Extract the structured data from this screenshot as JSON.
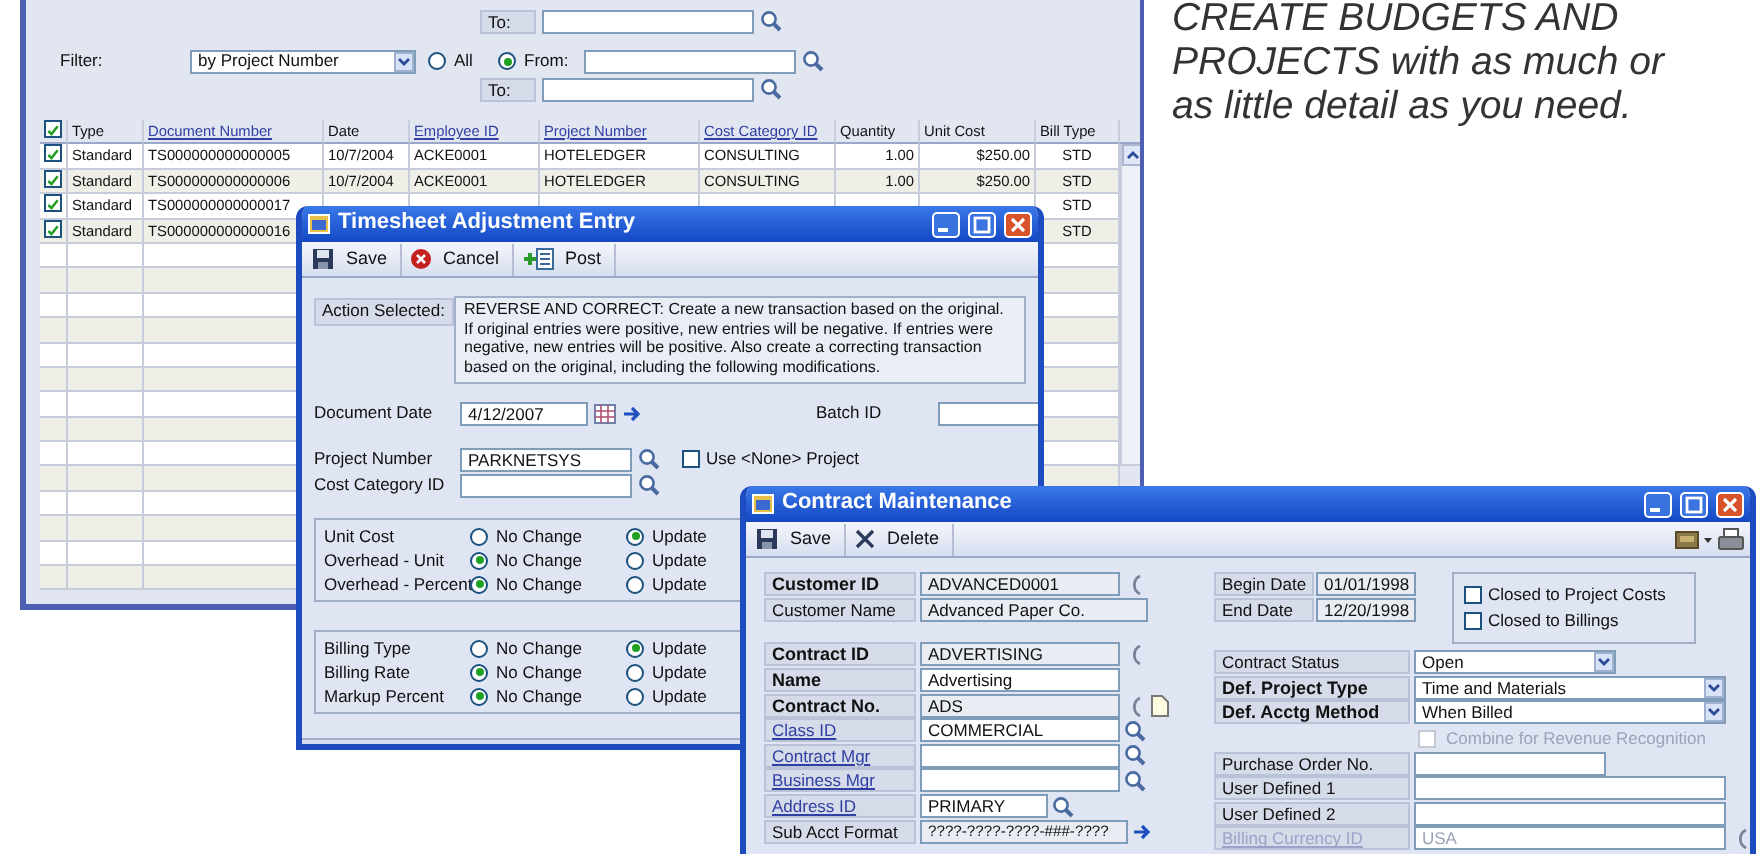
{
  "caption": "CREATE BUDGETS AND PROJECTS with as much or as little detail as you need.",
  "inquiry_window": {
    "top_range": {
      "to_label": "To:"
    },
    "filter": {
      "label": "Filter:",
      "value": "by Project Number",
      "options": [
        {
          "label": "All",
          "selected": false
        },
        {
          "label": "From:",
          "selected": true
        }
      ],
      "to_label": "To:"
    },
    "table": {
      "all_checked": true,
      "columns": [
        {
          "label": "Type",
          "link": false
        },
        {
          "label": "Document Number",
          "link": true
        },
        {
          "label": "Date",
          "link": false
        },
        {
          "label": "Employee ID",
          "link": true
        },
        {
          "label": "Project Number",
          "link": true
        },
        {
          "label": "Cost Category ID",
          "link": true
        },
        {
          "label": "Quantity",
          "link": false
        },
        {
          "label": "Unit Cost",
          "link": false
        },
        {
          "label": "Bill Type",
          "link": false
        }
      ],
      "rows": [
        {
          "checked": true,
          "cells": [
            "Standard",
            "TS000000000000005",
            "10/7/2004",
            "ACKE0001",
            "HOTELEDGER",
            "CONSULTING",
            "1.00",
            "$250.00",
            "STD"
          ]
        },
        {
          "checked": true,
          "cells": [
            "Standard",
            "TS000000000000006",
            "10/7/2004",
            "ACKE0001",
            "HOTELEDGER",
            "CONSULTING",
            "1.00",
            "$250.00",
            "STD"
          ]
        },
        {
          "checked": true,
          "cells": [
            "Standard",
            "TS000000000000017",
            null,
            null,
            null,
            null,
            null,
            null,
            "STD"
          ]
        },
        {
          "checked": true,
          "cells": [
            "Standard",
            "TS000000000000016",
            null,
            null,
            null,
            null,
            null,
            null,
            "STD"
          ]
        }
      ]
    }
  },
  "timesheet_window": {
    "title": "Timesheet Adjustment Entry",
    "toolbar": [
      {
        "kind": "save",
        "label": "Save"
      },
      {
        "kind": "cancel",
        "label": "Cancel"
      },
      {
        "kind": "post",
        "label": "Post"
      }
    ],
    "action": {
      "label": "Action Selected:",
      "text": "REVERSE AND CORRECT: Create a new transaction based on the original. If original entries were positive, new entries will be negative. If entries were negative, new entries will be positive. Also create a correcting transaction based on the original, including the following modifications."
    },
    "document_date": {
      "label": "Document Date",
      "value": "4/12/2007"
    },
    "batch_id": {
      "label": "Batch ID"
    },
    "project_number": {
      "label": "Project Number",
      "value": "PARKNETSYS"
    },
    "use_none_project": {
      "label": "Use <None> Project",
      "checked": false
    },
    "cost_category": {
      "label": "Cost Category ID"
    },
    "groups": [
      [
        {
          "label": "Unit Cost",
          "options": [
            {
              "label": "No Change",
              "selected": false
            },
            {
              "label": "Update",
              "selected": true
            }
          ]
        },
        {
          "label": "Overhead - Unit",
          "options": [
            {
              "label": "No Change",
              "selected": true
            },
            {
              "label": "Update",
              "selected": false
            }
          ]
        },
        {
          "label": "Overhead - Percent",
          "options": [
            {
              "label": "No Change",
              "selected": true
            },
            {
              "label": "Update",
              "selected": false
            }
          ]
        }
      ],
      [
        {
          "label": "Billing Type",
          "options": [
            {
              "label": "No Change",
              "selected": false
            },
            {
              "label": "Update",
              "selected": true
            }
          ]
        },
        {
          "label": "Billing Rate",
          "options": [
            {
              "label": "No Change",
              "selected": true
            },
            {
              "label": "Update",
              "selected": false
            }
          ]
        },
        {
          "label": "Markup Percent",
          "options": [
            {
              "label": "No Change",
              "selected": true
            },
            {
              "label": "Update",
              "selected": false
            }
          ]
        }
      ]
    ]
  },
  "contract_window": {
    "title": "Contract Maintenance",
    "toolbar": [
      {
        "kind": "save",
        "label": "Save"
      },
      {
        "kind": "delete",
        "label": "Delete"
      }
    ],
    "left_sections": [
      [
        {
          "label": "Customer ID",
          "required": true,
          "link": false,
          "value": "ADVANCED0001",
          "readonly": true,
          "kind": "ring"
        },
        {
          "label": "Customer Name",
          "required": false,
          "link": false,
          "value": "Advanced Paper Co.",
          "readonly": true,
          "kind": "wide"
        }
      ],
      [
        {
          "label": "Contract ID",
          "required": true,
          "link": false,
          "value": "ADVERTISING",
          "readonly": true,
          "kind": "ring"
        },
        {
          "label": "Name",
          "required": true,
          "link": false,
          "value": "Advertising",
          "readonly": false,
          "kind": "text"
        },
        {
          "label": "Contract No.",
          "required": true,
          "link": false,
          "value": "ADS",
          "readonly": true,
          "kind": "ring-note"
        },
        {
          "label": "Class ID",
          "required": false,
          "link": true,
          "value": "COMMERCIAL",
          "readonly": false,
          "kind": "lookup"
        },
        {
          "label": "Contract Mgr",
          "required": false,
          "link": true,
          "readonly": false,
          "kind": "lookup"
        },
        {
          "label": "Business Mgr",
          "required": false,
          "link": true,
          "readonly": false,
          "kind": "lookup"
        },
        {
          "label": "Address ID",
          "required": false,
          "link": true,
          "value": "PRIMARY",
          "readonly": false,
          "kind": "lookup-short"
        },
        {
          "label": "Sub Acct Format",
          "required": false,
          "link": false,
          "value": "????-????-????-###-????",
          "readonly": true,
          "kind": "arrow"
        }
      ]
    ],
    "dates": [
      {
        "label": "Begin Date",
        "value": "01/01/1998"
      },
      {
        "label": "End Date",
        "value": "12/20/1998"
      }
    ],
    "closed_checks": [
      {
        "label": "Closed to Project Costs",
        "checked": false
      },
      {
        "label": "Closed to Billings",
        "checked": false
      }
    ],
    "right_fields": [
      {
        "label": "Contract Status",
        "required": false,
        "link": false,
        "value": "Open",
        "kind": "dropdown-short",
        "disabled": false
      },
      {
        "label": "Def. Project Type",
        "required": true,
        "link": false,
        "value": "Time and Materials",
        "kind": "dropdown",
        "disabled": false
      },
      {
        "label": "Def. Acctg Method",
        "required": true,
        "link": false,
        "value": "When Billed",
        "kind": "dropdown",
        "disabled": false
      },
      {
        "label": "Combine for Revenue Recognition",
        "kind": "checkbox",
        "checked": false,
        "disabled": true
      },
      {
        "label": "Purchase Order No.",
        "required": false,
        "link": false,
        "kind": "short",
        "disabled": false
      },
      {
        "label": "User Defined 1",
        "required": false,
        "link": false,
        "kind": "text",
        "disabled": false
      },
      {
        "label": "User Defined 2",
        "required": false,
        "link": false,
        "kind": "text",
        "disabled": false
      },
      {
        "label": "Billing Currency ID",
        "required": false,
        "link": true,
        "value": "USA",
        "kind": "ring-note",
        "disabled": true
      }
    ]
  }
}
